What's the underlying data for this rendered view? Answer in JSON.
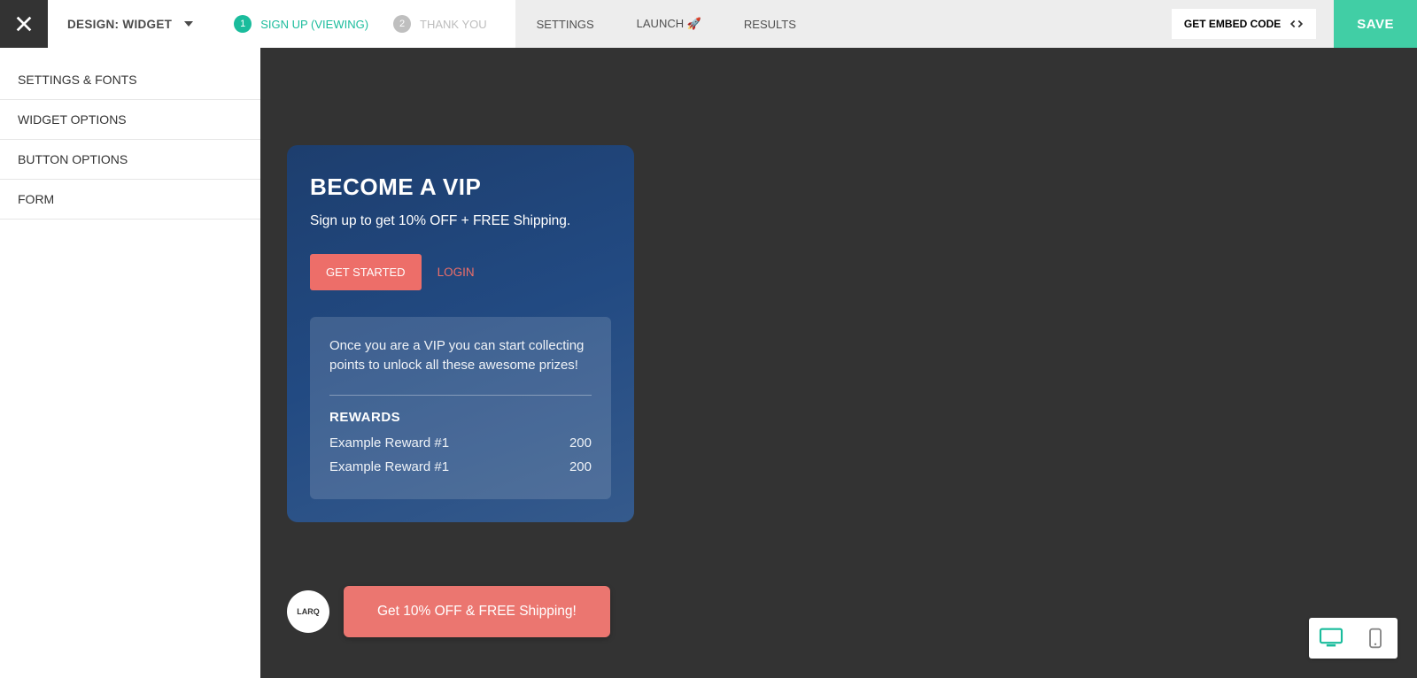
{
  "header": {
    "design_label": "DESIGN: WIDGET",
    "steps": [
      {
        "num": "1",
        "label": "SIGN UP (VIEWING)",
        "active": true
      },
      {
        "num": "2",
        "label": "THANK YOU",
        "active": false
      }
    ],
    "nav": [
      {
        "label": "SETTINGS"
      },
      {
        "label": "LAUNCH 🚀"
      },
      {
        "label": "RESULTS"
      }
    ],
    "embed_label": "GET EMBED CODE",
    "save_label": "SAVE"
  },
  "sidebar": {
    "items": [
      {
        "label": "SETTINGS & FONTS"
      },
      {
        "label": "WIDGET OPTIONS"
      },
      {
        "label": "BUTTON OPTIONS"
      },
      {
        "label": "FORM"
      }
    ]
  },
  "widget": {
    "title": "BECOME A VIP",
    "subtitle": "Sign up to get 10% OFF + FREE Shipping.",
    "primary_btn": "GET STARTED",
    "login": "LOGIN",
    "card": {
      "desc": "Once you are a VIP you can start collecting points to unlock all these awesome prizes!",
      "rewards_header": "REWARDS",
      "rewards": [
        {
          "name": "Example Reward #1",
          "points": "200"
        },
        {
          "name": "Example Reward #1",
          "points": "200"
        }
      ]
    }
  },
  "floater": {
    "logo": "LARQ",
    "cta": "Get 10% OFF & FREE Shipping!"
  }
}
